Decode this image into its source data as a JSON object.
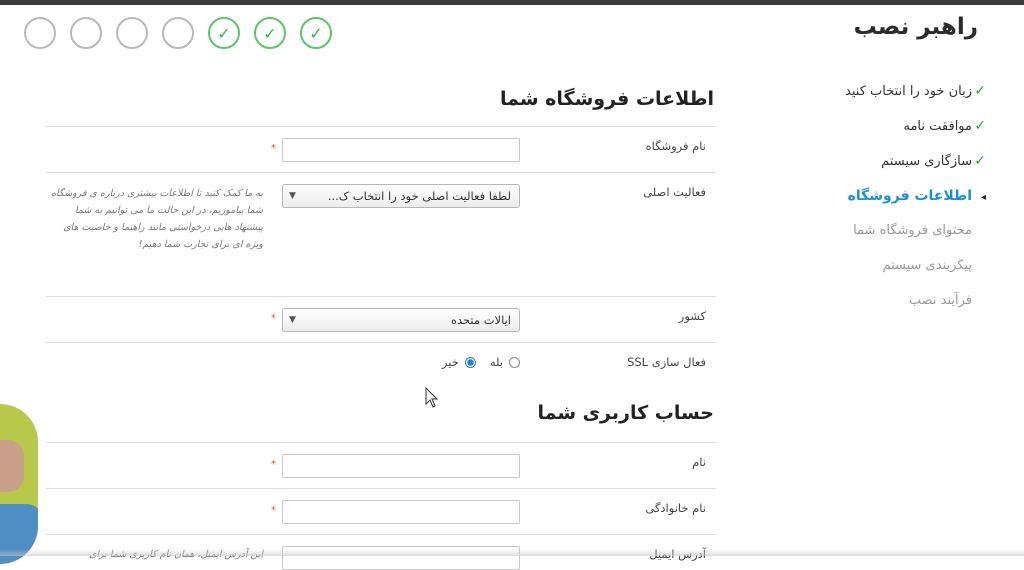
{
  "wizard": {
    "title": "راهبر نصب",
    "steps": [
      {
        "state": "pending",
        "glyph": ""
      },
      {
        "state": "pending",
        "glyph": ""
      },
      {
        "state": "pending",
        "glyph": ""
      },
      {
        "state": "pending",
        "glyph": ""
      },
      {
        "state": "done",
        "glyph": "✓"
      },
      {
        "state": "done",
        "glyph": "✓"
      },
      {
        "state": "done",
        "glyph": "✓"
      }
    ]
  },
  "sidebar": {
    "items": [
      {
        "label": "زبان خود را انتخاب کنید",
        "mark": "✓",
        "state": "done"
      },
      {
        "label": "موافقت نامه",
        "mark": "✓",
        "state": "done"
      },
      {
        "label": "سازگاری سیستم",
        "mark": "✓",
        "state": "done"
      },
      {
        "label": "اطلاعات فروشگاه",
        "mark": "◂",
        "state": "current"
      },
      {
        "label": "محتوای فروشگاه شما",
        "mark": "",
        "state": "future"
      },
      {
        "label": "پیکربندی سیستم",
        "mark": "",
        "state": "future"
      },
      {
        "label": "فرآیند نصب",
        "mark": "",
        "state": "future"
      }
    ]
  },
  "store_section": {
    "title": "اطلاعات فروشگاه شما",
    "shop_name": {
      "label": "نام فروشگاه",
      "value": "",
      "required": "*"
    },
    "activity": {
      "label": "فعالیت اصلی",
      "selected": "لطفا فعالیت اصلی خود را انتخاب ک...",
      "help": "به ما کمک کنید تا اطلاعات بیشتری درباره ی فروشگاه شما بیاموزیم، در این حالت ما می توانیم به شما پیشنهاد هایی درخواستی مانند راهنما و خاصیت های ویژه ای برای تجارت شما دهیم!"
    },
    "country": {
      "label": "کشور",
      "selected": "ایالات متحده",
      "required": "*"
    },
    "ssl": {
      "label": "فعال سازی SSL",
      "yes": "بله",
      "no": "خیر",
      "selected": "no"
    }
  },
  "account_section": {
    "title": "حساب کاربری شما",
    "first_name": {
      "label": "نام",
      "value": "",
      "required": "*"
    },
    "last_name": {
      "label": "نام خانوادگی",
      "value": "",
      "required": "*"
    },
    "email": {
      "label": "آدرس ایمیل",
      "help": "این آدرس ایمیل، همان نام کاربری شما برای"
    }
  },
  "icons": {
    "arrow": "chevron-down-icon",
    "check": "check-icon",
    "cursor": "mouse-pointer-icon"
  },
  "colors": {
    "accent": "#1a8fd1",
    "success": "#3bb34a",
    "required": "#e74c3c"
  }
}
